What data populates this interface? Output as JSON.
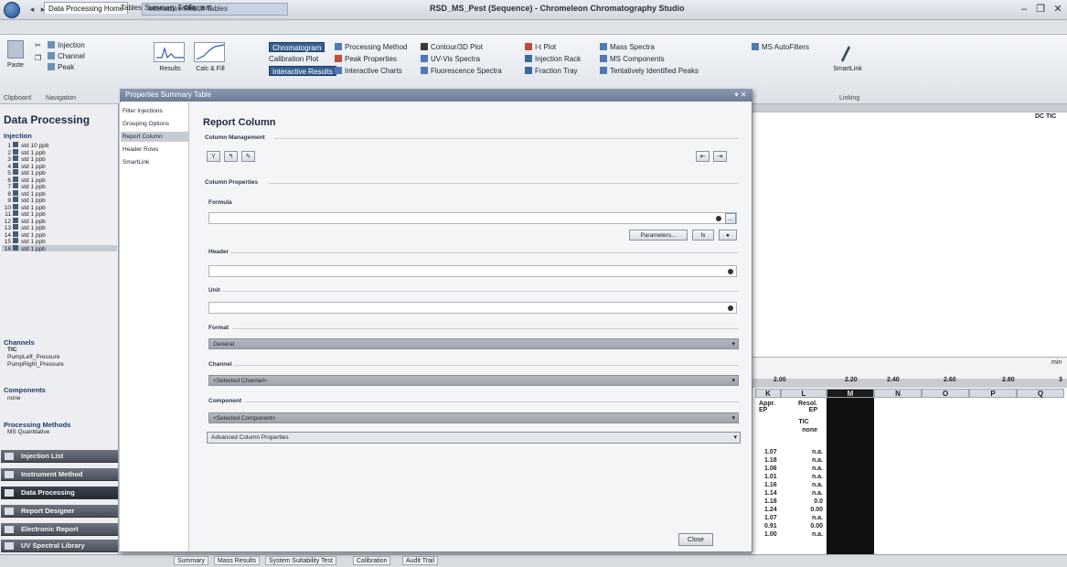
{
  "window": {
    "document_tab": "Interactive Result Tables",
    "title": "RSD_MS_Pest (Sequence) - Chromeleon Chromatography Studio",
    "minimize": "–",
    "restore": "❐",
    "close": "✕"
  },
  "ribbon_tabs": [
    "Data Processing Home",
    "Tables",
    "Summary Table",
    "Format"
  ],
  "ribbon": {
    "paste_label": "Paste",
    "clipboard_label": "Clipboard",
    "navigation_label": "Navigation",
    "nav_items": [
      "Injection",
      "Channel",
      "Peak"
    ],
    "results_label": "Results",
    "calc_label": "Calc & Fill",
    "view_items": [
      "Chromatogram",
      "Calibration Plot",
      "Interactive Results"
    ],
    "col2": [
      "Processing Method",
      "Peak Properties",
      "Interactive Charts"
    ],
    "col3": [
      "Contour/3D Plot",
      "UV-Vis Spectra",
      "Fluorescence Spectra"
    ],
    "col4": [
      "I-t Plot",
      "Injection Rack",
      "Fraction Tray"
    ],
    "col5": [
      "Mass Spectra",
      "MS Components",
      "Tentatively Identified Peaks"
    ],
    "col6": [
      "MS AutoFilters"
    ],
    "smartlink_label": "SmartLink",
    "linking_label": "Linking"
  },
  "left_panel": {
    "title": "Data Processing",
    "injections_header": "Injection",
    "injections": [
      {
        "n": "1",
        "name": "std 10 ppb"
      },
      {
        "n": "2",
        "name": "std 1 ppb"
      },
      {
        "n": "3",
        "name": "std 1 ppb"
      },
      {
        "n": "4",
        "name": "std 1 ppb"
      },
      {
        "n": "5",
        "name": "std 1 ppb"
      },
      {
        "n": "6",
        "name": "std 1 ppb"
      },
      {
        "n": "7",
        "name": "std 1 ppb"
      },
      {
        "n": "8",
        "name": "std 1 ppb"
      },
      {
        "n": "9",
        "name": "std 1 ppb"
      },
      {
        "n": "10",
        "name": "std 1 ppb"
      },
      {
        "n": "11",
        "name": "std 1 ppb"
      },
      {
        "n": "12",
        "name": "std 1 ppb"
      },
      {
        "n": "13",
        "name": "std 1 ppb"
      },
      {
        "n": "14",
        "name": "std 1 ppb"
      },
      {
        "n": "15",
        "name": "std 1 ppb"
      },
      {
        "n": "16",
        "name": "std 1 ppb"
      }
    ],
    "channels_header": "Channels",
    "channels": [
      "TIC",
      "PumpLeft_Pressure",
      "PumpRight_Pressure"
    ],
    "components_header": "Components",
    "components": [
      "none"
    ],
    "pm_header": "Processing Methods",
    "pm_items": [
      "MS Quantitative"
    ],
    "nav_buttons": [
      "Injection List",
      "Instrument Method",
      "Data Processing",
      "Report Designer",
      "Electronic Report",
      "UV Spectral Library"
    ]
  },
  "dialog": {
    "title": "Properties Summary Table",
    "close_x": "▾ ✕",
    "nav": [
      "Filter Injections",
      "Grouping Options",
      "Report Column",
      "Header Rows",
      "SmartLink"
    ],
    "section_title": "Report Column",
    "column_management": "Column Management",
    "column_properties": "Column Properties",
    "formula_label": "Formula",
    "formula_value": "",
    "parameters_button": "Parameters...",
    "header_label": "Header",
    "header_value": "",
    "unit_label": "Unit",
    "unit_value": "",
    "format_label": "Format",
    "format_value": "General",
    "channel_label": "Channel",
    "channel_value": "<Selected Channel>",
    "component_label": "Component",
    "component_value": "<Selected Component>",
    "advanced_label": "Advanced Column Properties",
    "close_button": "Close"
  },
  "chart": {
    "channel_label": "DC TIC",
    "ticks": [
      "2.00",
      "2.20",
      "2.40",
      "2.60",
      "2.80",
      "3"
    ],
    "unit": "min"
  },
  "table": {
    "columns": [
      "K",
      "L",
      "M",
      "N",
      "O",
      "P",
      "Q"
    ],
    "header_k": "Appr. EP",
    "header_l": "Resol. EP",
    "header_l2": "TIC",
    "header_l3": "none",
    "k_values": [
      "1.07",
      "1.18",
      "1.06",
      "1.01",
      "1.16",
      "1.14",
      "1.18",
      "1.24",
      "1.07",
      "0.91",
      "1.00"
    ],
    "l_values": [
      "n.a.",
      "n.a.",
      "n.a.",
      "n.a.",
      "n.a.",
      "n.a.",
      "0.0",
      "0.00",
      "n.a.",
      "0.00",
      "n.a."
    ]
  },
  "status_tabs": [
    "Summary",
    "Mass Results",
    "System Suitability Test",
    "Calibration",
    "Audit Trail"
  ]
}
